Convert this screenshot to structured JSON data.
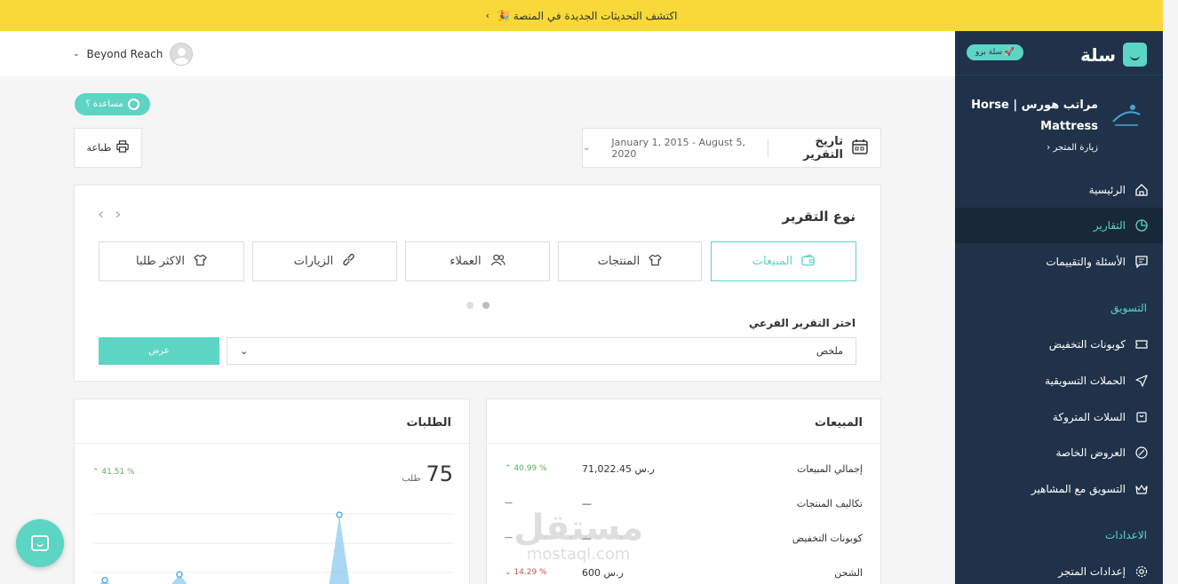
{
  "banner": {
    "text": "🎉 اكتشف التحديثات الجديدة في المنصة",
    "chevron": "‹"
  },
  "topbar": {
    "user_name": "Beyond Reach"
  },
  "help": {
    "label": "مساعدة ؟"
  },
  "print": {
    "label": "طباعة"
  },
  "date_filter": {
    "label": "تاريخ التقرير",
    "value": "January 1, 2015 - August 5, 2020"
  },
  "report_type": {
    "title": "نوع التقرير",
    "tiles": [
      {
        "label": "المبيعات",
        "icon": "wallet-icon"
      },
      {
        "label": "المنتجات",
        "icon": "shirt-icon"
      },
      {
        "label": "العملاء",
        "icon": "users-icon"
      },
      {
        "label": "الزيارات",
        "icon": "link-icon"
      },
      {
        "label": "الاكثر طلبا",
        "icon": "shirt-icon"
      }
    ],
    "sub_label": "اختر التقرير الفرعي",
    "sub_value": "ملخص",
    "show_button": "عرض"
  },
  "sales": {
    "title": "المبيعات",
    "rows": [
      {
        "label": "إجمالي المبيعات",
        "value": "71,022.45 ر.س",
        "pct": "40.99 %",
        "dir": "up"
      },
      {
        "label": "تكاليف المنتجات",
        "value": "—",
        "pct": "—",
        "dir": "none"
      },
      {
        "label": "كوبونات التخفيض",
        "value": "—",
        "pct": "—",
        "dir": "none"
      },
      {
        "label": "الشحن",
        "value": "600 ر.س",
        "pct": "14.29 %",
        "dir": "down"
      }
    ]
  },
  "orders": {
    "title": "الطلبات",
    "count": "75",
    "unit": "طلب",
    "pct": "41.51 %"
  },
  "orders_chart": {
    "type": "area",
    "peaks": [
      0.1,
      0.18,
      1.0
    ]
  },
  "sidebar": {
    "brand": "سلة",
    "pro_label": "سلة برو",
    "store_name": "مراتب هورس | Horse Mattress",
    "visit_store": "زيارة المتجر",
    "items": [
      {
        "label": "الرئيسية",
        "icon": "home-icon"
      },
      {
        "label": "التقارير",
        "icon": "pie-chart-icon"
      },
      {
        "label": "الأسئلة والتقييمات",
        "icon": "message-icon"
      }
    ],
    "marketing_title": "التسويق",
    "marketing_items": [
      {
        "label": "كوبونات التخفيض",
        "icon": "ticket-icon"
      },
      {
        "label": "الحملات التسويقية",
        "icon": "send-icon"
      },
      {
        "label": "السلات المتروكة",
        "icon": "cart-icon"
      },
      {
        "label": "العروض الخاصة",
        "icon": "percent-icon"
      },
      {
        "label": "التسويق مع المشاهير",
        "icon": "crown-icon"
      }
    ],
    "settings_title": "الاعدادات",
    "settings_items": [
      {
        "label": "إعدادات المتجر",
        "icon": "gear-icon"
      }
    ]
  },
  "watermark": {
    "line1": "مستقل",
    "line2": "mostaql.com"
  },
  "colors": {
    "accent": "#5dd5c4",
    "banner": "#f8d937",
    "sidebar": "#1f3249"
  }
}
